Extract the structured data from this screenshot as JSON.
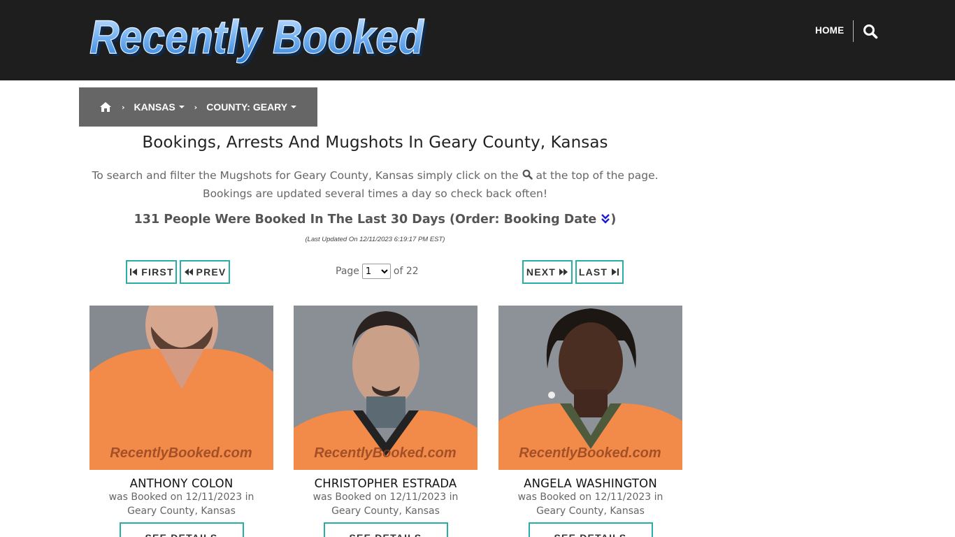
{
  "header": {
    "logo_text": "Recently Booked",
    "nav_home": "HOME",
    "search_icon": "search-icon"
  },
  "breadcrumb": {
    "home_icon": "home-icon",
    "state": "KANSAS",
    "county": "COUNTY: GEARY"
  },
  "main": {
    "title": "Bookings, Arrests And Mugshots In Geary County, Kansas",
    "intro_before_icon": "To search and filter the Mugshots for Geary County, Kansas simply click on the",
    "intro_after_icon": "at the top of the page. Bookings are updated several times a day so check back often!",
    "count_text": "131 People Were Booked In The Last 30 Days (Order: Booking Date",
    "count_close": ")",
    "last_updated": "(Last Updated On 12/11/2023 6:19:17 PM EST)"
  },
  "pagination": {
    "first": "FIRST",
    "prev": "PREV",
    "next": "NEXT",
    "last": "LAST",
    "page_label": "Page",
    "current_page": "1",
    "of_label": "of 22"
  },
  "watermark": "RecentlyBooked.com",
  "cards": [
    {
      "name": "ANTHONY COLON",
      "booked_text": "was Booked on 12/11/2023 in Geary County, Kansas",
      "button": "SEE DETAILS"
    },
    {
      "name": "CHRISTOPHER ESTRADA",
      "booked_text": "was Booked on 12/11/2023 in Geary County, Kansas",
      "button": "SEE DETAILS"
    },
    {
      "name": "ANGELA WASHINGTON",
      "booked_text": "was Booked on 12/11/2023 in Geary County, Kansas",
      "button": "SEE DETAILS"
    }
  ],
  "colors": {
    "header_bg": "#1e1e1e",
    "breadcrumb_bg": "#666666",
    "accent_teal": "#2aada5",
    "jumpsuit_orange": "#f28a4a",
    "logo_blue": "#5aa8f0"
  }
}
